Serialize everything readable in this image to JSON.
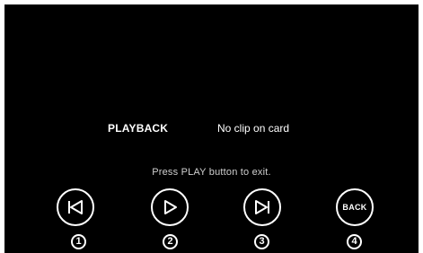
{
  "screen": {
    "mode_label": "PLAYBACK",
    "status_text": "No clip on card",
    "instruction": "Press PLAY button to exit."
  },
  "controls": {
    "previous": {
      "icon": "skip-previous-icon",
      "number": "1"
    },
    "play": {
      "icon": "play-icon",
      "number": "2"
    },
    "next": {
      "icon": "skip-next-icon",
      "number": "3"
    },
    "back": {
      "label": "BACK",
      "number": "4"
    }
  },
  "colors": {
    "background": "#000000",
    "foreground": "#ffffff",
    "instruction": "#cfcfcf"
  }
}
